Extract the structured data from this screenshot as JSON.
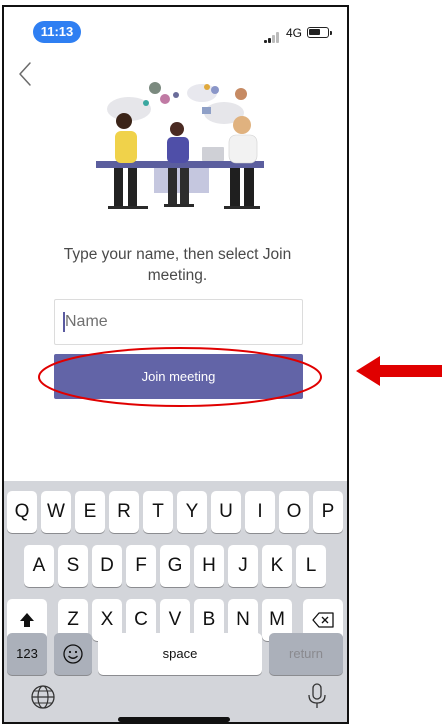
{
  "status_bar": {
    "time": "11:13",
    "network": "4G",
    "time_pill_color": "#2f7ff2"
  },
  "header": {
    "back_icon": "chevron-left-icon"
  },
  "prompt": {
    "instruction": "Type your name, then select Join meeting."
  },
  "form": {
    "name_placeholder": "Name",
    "name_value": "",
    "join_label": "Join meeting",
    "join_button_color": "#6264a7"
  },
  "annotation": {
    "highlight_color": "#e00000",
    "arrow_color": "#e00000"
  },
  "keyboard": {
    "row1": [
      "Q",
      "W",
      "E",
      "R",
      "T",
      "Y",
      "U",
      "I",
      "O",
      "P"
    ],
    "row2": [
      "A",
      "S",
      "D",
      "F",
      "G",
      "H",
      "J",
      "K",
      "L"
    ],
    "row3": [
      "Z",
      "X",
      "C",
      "V",
      "B",
      "N",
      "M"
    ],
    "numbers_label": "123",
    "space_label": "space",
    "return_label": "return",
    "shift_icon": "shift-icon",
    "delete_icon": "delete-icon",
    "emoji_icon": "emoji-icon",
    "globe_icon": "globe-icon",
    "mic_icon": "microphone-icon"
  }
}
